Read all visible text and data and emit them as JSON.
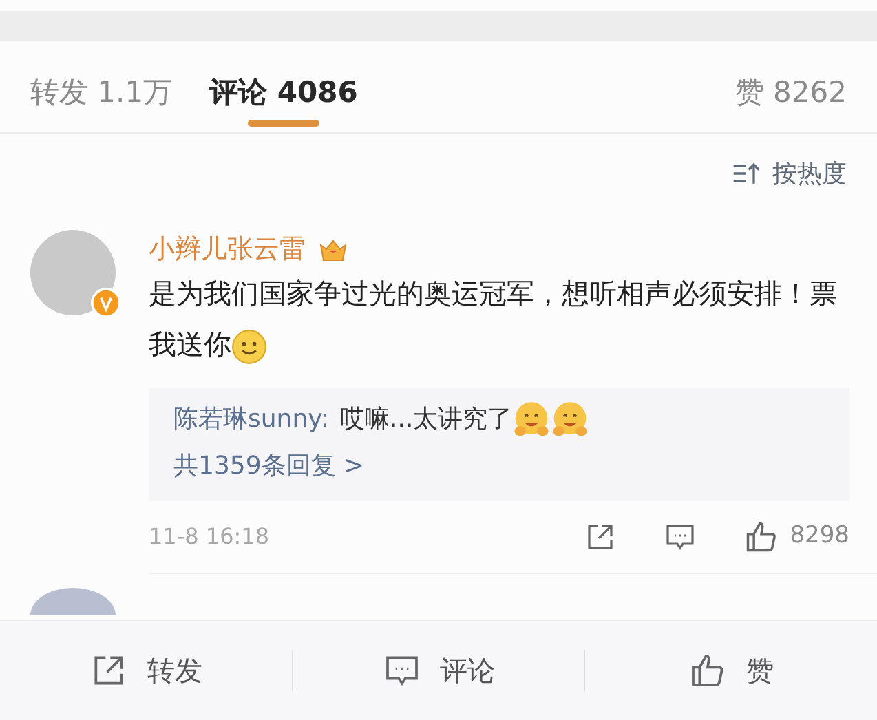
{
  "tabs": [
    {
      "label": "转发 1.1万",
      "selected": false
    },
    {
      "label": "评论 4086",
      "selected": true
    },
    {
      "label": "赞 8262",
      "selected": false
    }
  ],
  "sort": {
    "label": "按热度"
  },
  "comments": [
    {
      "name": "小辫儿张云雷",
      "verified": true,
      "text": "是为我们国家争过光的奥运冠军，想听相声必须安排！票我送你",
      "emoji": [
        {
          "kind": "smile"
        }
      ],
      "reply": {
        "author": "陈若琳sunny:",
        "text": "哎嘛...太讲究了",
        "emoji": [
          {
            "kind": "hug"
          },
          {
            "kind": "hug"
          }
        ],
        "more": "共1359条回复 >"
      },
      "time": "11-8 16:18",
      "likes": "8298"
    }
  ],
  "bottom_bar": [
    {
      "kind": "share",
      "label": "转发"
    },
    {
      "kind": "comment",
      "label": "评论"
    },
    {
      "kind": "like",
      "label": "赞"
    }
  ]
}
